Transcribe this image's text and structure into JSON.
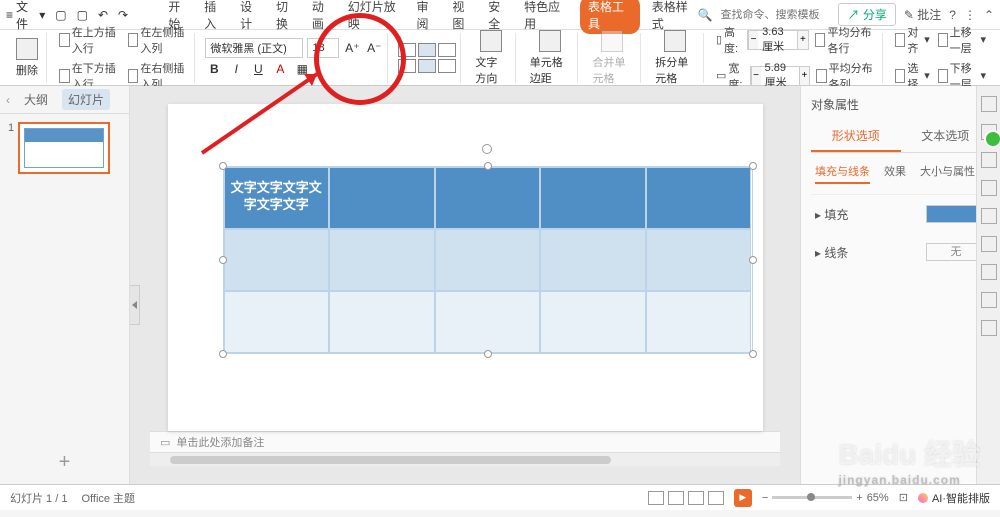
{
  "menu": {
    "file": "文件",
    "items": [
      "开始",
      "插入",
      "设计",
      "切换",
      "动画",
      "幻灯片放映",
      "审阅",
      "视图",
      "安全",
      "特色应用"
    ],
    "active": "表格工具",
    "extra": "表格样式",
    "search_placeholder": "查找命令、搜索模板",
    "share": "分享",
    "comment": "批注"
  },
  "ribbon": {
    "delete": "删除",
    "insert_row_above": "在上方插入行",
    "insert_row_below": "在下方插入行",
    "insert_col_left": "在左侧插入列",
    "insert_col_right": "在右侧插入列",
    "font_name": "微软雅黑 (正文)",
    "font_size": "18",
    "text_dir": "文字方向",
    "cell_margin": "单元格边距",
    "merge": "合并单元格",
    "split": "拆分单元格",
    "height_label": "高度:",
    "height_val": "3.63厘米",
    "width_label": "宽度:",
    "width_val": "5.89厘米",
    "dist_rows": "平均分布各行",
    "dist_cols": "平均分布各列",
    "align": "对齐",
    "select": "选择",
    "move_up": "上移一层",
    "move_down": "下移一层"
  },
  "thumb": {
    "outline": "大纲",
    "slides": "幻灯片",
    "num": "1"
  },
  "slide": {
    "cell_text": "文字文字文字文字文字文字"
  },
  "notes": {
    "placeholder": "单击此处添加备注"
  },
  "props": {
    "title": "对象属性",
    "tab_shape": "形状选项",
    "tab_text": "文本选项",
    "sub_fill": "填充与线条",
    "sub_effect": "效果",
    "sub_size": "大小与属性",
    "fill": "填充",
    "line": "线条",
    "none": "无"
  },
  "status": {
    "page": "幻灯片 1 / 1",
    "theme": "Office 主题",
    "zoom": "65%",
    "ai": "AI·智能排版"
  },
  "watermark": {
    "main": "Baidu 经验",
    "sub": "jingyan.baidu.com"
  }
}
